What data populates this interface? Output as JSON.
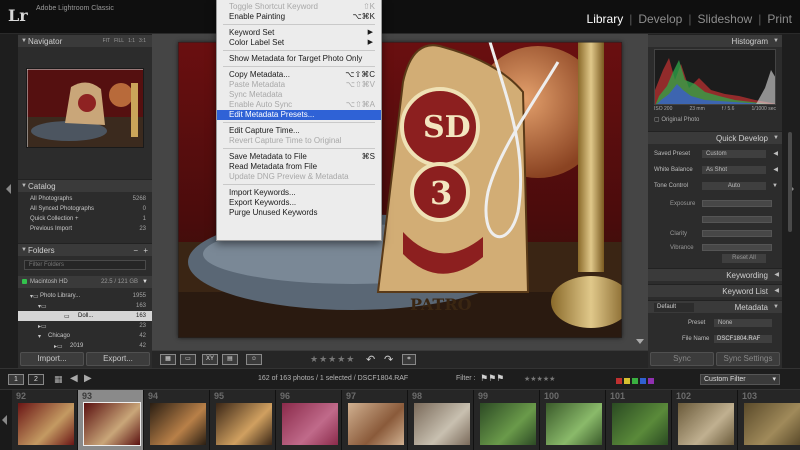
{
  "app": {
    "logo": "Lr",
    "title": "Adobe Lightroom Classic",
    "modules": [
      "Library",
      "Develop",
      "Slideshow",
      "Print"
    ],
    "active_module": "Library"
  },
  "navigator": {
    "title": "Navigator",
    "opts": [
      "FIT",
      "FILL",
      "1:1",
      "3:1"
    ]
  },
  "catalog": {
    "title": "Catalog",
    "items": [
      {
        "label": "All Photographs",
        "count": "5268"
      },
      {
        "label": "All Synced Photographs",
        "count": "0"
      },
      {
        "label": "Quick Collection +",
        "count": "1"
      },
      {
        "label": "Previous Import",
        "count": "23"
      }
    ]
  },
  "folders": {
    "title": "Folders",
    "filter_placeholder": "Filter Folders",
    "volume": {
      "label": "Macintosh HD",
      "space": "22.5 / 121 GB"
    },
    "items": [
      {
        "label": "Photo Library...",
        "count": "1955"
      },
      {
        "label": "",
        "count": "163"
      },
      {
        "label": "Doll...",
        "count": "163"
      },
      {
        "label": "",
        "count": "23"
      },
      {
        "label": "Chicago",
        "count": "42"
      },
      {
        "label": "2019",
        "count": "42"
      }
    ]
  },
  "left_buttons": {
    "import": "Import...",
    "export": "Export..."
  },
  "histogram": {
    "title": "Histogram",
    "info": [
      "ISO 200",
      "23 mm",
      "f / 5.6",
      "1/1000 sec"
    ],
    "original_photo": "Original Photo"
  },
  "quick_develop": {
    "title": "Quick Develop",
    "saved_preset_label": "Saved Preset",
    "saved_preset_value": "Custom",
    "white_balance_label": "White Balance",
    "white_balance_value": "As Shot",
    "tone_control_label": "Tone Control",
    "auto_label": "Auto",
    "rows": [
      "Exposure",
      "Clarity",
      "Vibrance"
    ],
    "reset_label": "Reset All"
  },
  "keywording": {
    "title": "Keywording"
  },
  "keyword_list": {
    "title": "Keyword List"
  },
  "metadata": {
    "title": "Metadata",
    "default_label": "Default",
    "preset_label": "Preset",
    "preset_value": "None",
    "file_name_label": "File Name",
    "file_name_value": "DSCF1804.RAF"
  },
  "sync_buttons": {
    "sync": "Sync",
    "sync_settings": "Sync Settings"
  },
  "menu": {
    "items": [
      {
        "label": "Toggle Shortcut Keyword",
        "shortcut": "⇧K",
        "disabled": true
      },
      {
        "label": "Enable Painting",
        "shortcut": "⌥⌘K",
        "disabled": false
      },
      {
        "sep": true
      },
      {
        "label": "Keyword Set",
        "submenu": true
      },
      {
        "label": "Color Label Set",
        "submenu": true
      },
      {
        "sep": true
      },
      {
        "label": "Show Metadata for Target Photo Only"
      },
      {
        "sep": true
      },
      {
        "label": "Copy Metadata...",
        "shortcut": "⌥⇧⌘C"
      },
      {
        "label": "Paste Metadata",
        "shortcut": "⌥⇧⌘V",
        "disabled": true
      },
      {
        "label": "Sync Metadata",
        "disabled": true
      },
      {
        "label": "Enable Auto Sync",
        "shortcut": "⌥⇧⌘A",
        "disabled": true
      },
      {
        "label": "Edit Metadata Presets...",
        "highlight": true
      },
      {
        "sep": true
      },
      {
        "label": "Edit Capture Time..."
      },
      {
        "label": "Revert Capture Time to Original",
        "disabled": true
      },
      {
        "sep": true
      },
      {
        "label": "Save Metadata to File",
        "shortcut": "⌘S"
      },
      {
        "label": "Read Metadata from File"
      },
      {
        "label": "Update DNG Preview & Metadata",
        "disabled": true
      },
      {
        "sep": true
      },
      {
        "label": "Import Keywords..."
      },
      {
        "label": "Export Keywords..."
      },
      {
        "label": "Purge Unused Keywords"
      }
    ]
  },
  "filmstrip_bar": {
    "page1": "1",
    "page2": "2",
    "status": "162 of 163 photos / 1 selected / DSCF1804.RAF",
    "filter_label": "Filter :",
    "filter_value": "Custom Filter"
  },
  "filmstrip": {
    "numbers": [
      "92",
      "93",
      "94",
      "95",
      "96",
      "97",
      "98",
      "99",
      "100",
      "101",
      "102",
      "103"
    ],
    "selected_index": 1
  },
  "colors": {
    "highlight": "#2f62d6",
    "panel": "#2c2c2c",
    "photo_red": "#5a1010"
  }
}
